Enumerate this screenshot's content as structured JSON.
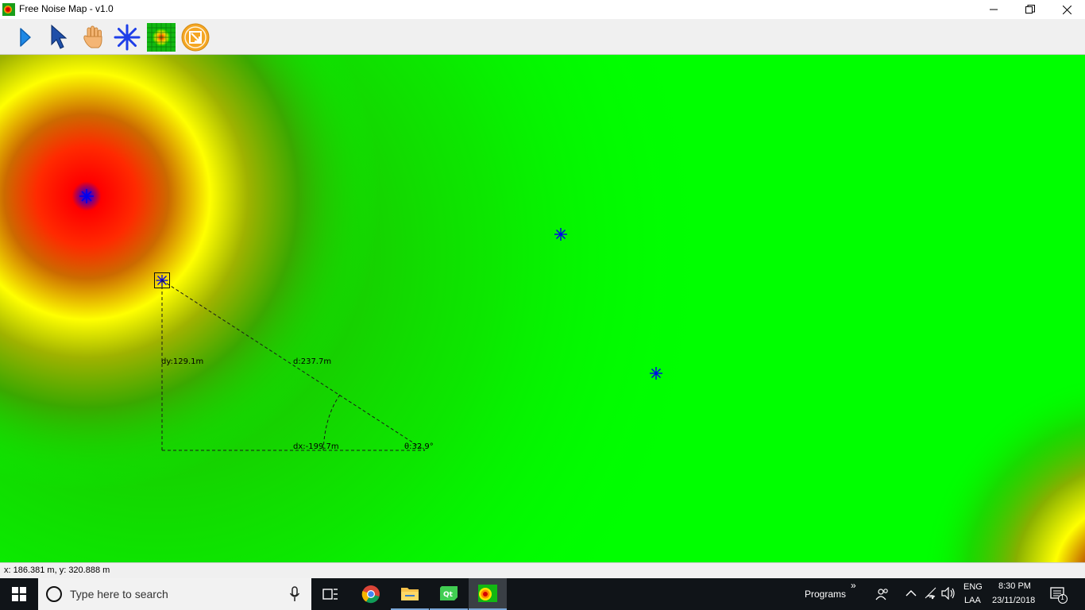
{
  "window": {
    "title": "Free Noise Map - v1.0"
  },
  "toolbar": {
    "tools": [
      {
        "icon": "play-icon"
      },
      {
        "icon": "pointer-arrow-icon"
      },
      {
        "icon": "hand-pan-icon"
      },
      {
        "icon": "noise-source-star-icon"
      },
      {
        "icon": "noise-grid-icon"
      },
      {
        "icon": "fit-to-window-icon"
      }
    ]
  },
  "map": {
    "measure": {
      "dy": "dy:129.1m",
      "d": "d:237.7m",
      "dx": "dx:-199.7m",
      "theta": "θ:32.9°"
    },
    "colors": {
      "base": "#00ff00",
      "mid": "#ffff00",
      "hot": "#ff0000",
      "source": "#0000ff"
    }
  },
  "status": {
    "coords": "x: 186.381 m, y: 320.888 m"
  },
  "taskbar": {
    "search_placeholder": "Type here to search",
    "programs_label": "Programs",
    "programs_chevron": "»",
    "lang_top": "ENG",
    "lang_bottom": "LAA",
    "time": "8:30 PM",
    "date": "23/11/2018",
    "notification_count": "1"
  }
}
